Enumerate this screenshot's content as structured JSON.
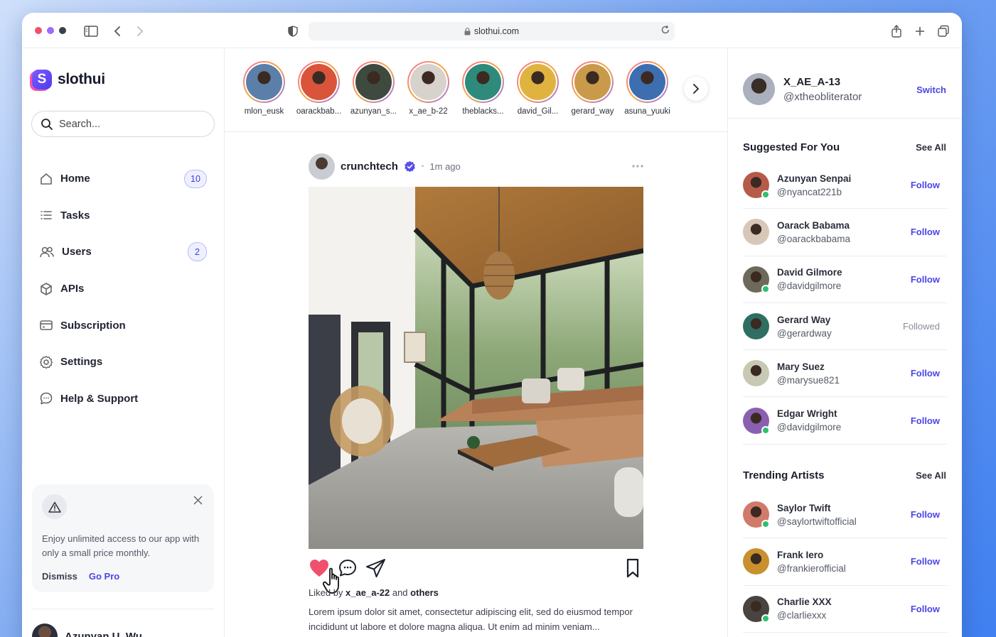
{
  "browser": {
    "url": "slothui.com"
  },
  "sidebar": {
    "brand": "slothui",
    "logo_letter": "S",
    "search_placeholder": "Search...",
    "nav": [
      {
        "label": "Home",
        "badge": "10",
        "icon": "home-icon"
      },
      {
        "label": "Tasks",
        "badge": "",
        "icon": "list-icon"
      },
      {
        "label": "Users",
        "badge": "2",
        "icon": "users-icon"
      },
      {
        "label": "APIs",
        "badge": "",
        "icon": "cube-icon"
      },
      {
        "label": "Subscription",
        "badge": "",
        "icon": "card-icon"
      },
      {
        "label": "Settings",
        "badge": "",
        "icon": "gear-icon"
      },
      {
        "label": "Help & Support",
        "badge": "",
        "icon": "chat-icon"
      }
    ],
    "promo": {
      "text": "Enjoy unlimited access to our app with only a small price monthly.",
      "dismiss": "Dismiss",
      "go_pro": "Go Pro"
    },
    "user": {
      "name": "Azunyan U. Wu"
    }
  },
  "stories": [
    {
      "name": "mlon_eusk",
      "color": "#5b7fa8"
    },
    {
      "name": "oarackbab...",
      "color": "#d9543a"
    },
    {
      "name": "azunyan_s...",
      "color": "#3f4a3e"
    },
    {
      "name": "x_ae_b-22",
      "color": "#d8d2cc"
    },
    {
      "name": "theblacks...",
      "color": "#2e8a7a"
    },
    {
      "name": "david_Gil...",
      "color": "#e0b340"
    },
    {
      "name": "gerard_way",
      "color": "#c99a4a"
    },
    {
      "name": "asuna_yuuki",
      "color": "#3d6fb0"
    }
  ],
  "post": {
    "author": "crunchtech",
    "time": "1m ago",
    "liked_prefix": "Liked by",
    "liked_user": "x_ae_a-22",
    "liked_and": "and",
    "liked_others": "others",
    "caption": "Lorem ipsum dolor sit amet, consectetur adipiscing elit, sed do eiusmod tempor incididunt ut labore et dolore magna aliqua. Ut enim ad minim veniam..."
  },
  "account": {
    "name": "X_AE_A-13",
    "handle": "@xtheobliterator",
    "switch": "Switch"
  },
  "suggested": {
    "title": "Suggested For You",
    "see_all": "See All",
    "people": [
      {
        "name": "Azunyan Senpai",
        "handle": "@nyancat221b",
        "action": "Follow",
        "online": true,
        "color": "#b65a4a"
      },
      {
        "name": "Oarack Babama",
        "handle": "@oarackbabama",
        "action": "Follow",
        "online": false,
        "color": "#d8c7b8"
      },
      {
        "name": "David Gilmore",
        "handle": "@davidgilmore",
        "action": "Follow",
        "online": true,
        "color": "#6d6a5a"
      },
      {
        "name": "Gerard Way",
        "handle": "@gerardway",
        "action": "Followed",
        "online": false,
        "color": "#2f6e63"
      },
      {
        "name": "Mary Suez",
        "handle": "@marysue821",
        "action": "Follow",
        "online": false,
        "color": "#c7c9b3"
      },
      {
        "name": "Edgar Wright",
        "handle": "@davidgilmore",
        "action": "Follow",
        "online": true,
        "color": "#8a5fb0"
      }
    ]
  },
  "trending": {
    "title": "Trending Artists",
    "see_all": "See All",
    "people": [
      {
        "name": "Saylor Twift",
        "handle": "@saylortwiftofficial",
        "action": "Follow",
        "online": true,
        "color": "#d07a6a"
      },
      {
        "name": "Frank Iero",
        "handle": "@frankierofficial",
        "action": "Follow",
        "online": false,
        "color": "#c9902e"
      },
      {
        "name": "Charlie XXX",
        "handle": "@clarliexxx",
        "action": "Follow",
        "online": true,
        "color": "#4a4440"
      }
    ]
  }
}
